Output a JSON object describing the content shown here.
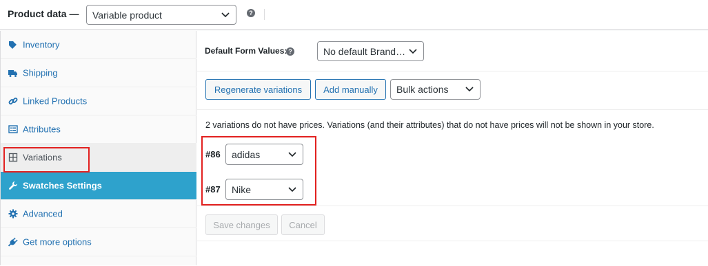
{
  "header": {
    "title": "Product data —",
    "product_type": "Variable product",
    "help_glyph": "?"
  },
  "sidebar": {
    "items": [
      {
        "label": "Inventory",
        "icon": "tag-icon"
      },
      {
        "label": "Shipping",
        "icon": "truck-icon"
      },
      {
        "label": "Linked Products",
        "icon": "link-icon"
      },
      {
        "label": "Attributes",
        "icon": "list-icon"
      },
      {
        "label": "Variations",
        "icon": "grid-icon",
        "state": "active"
      },
      {
        "label": "Swatches Settings",
        "icon": "wrench-icon",
        "state": "highlighted"
      },
      {
        "label": "Advanced",
        "icon": "gear-icon"
      },
      {
        "label": "Get more options",
        "icon": "plugin-icon"
      }
    ]
  },
  "panel": {
    "default_form_values_label": "Default Form Values:",
    "default_form_value": "No default Brand…",
    "buttons": {
      "regenerate": "Regenerate variations",
      "add_manually": "Add manually",
      "bulk_actions": "Bulk actions"
    },
    "notice": "2 variations do not have prices. Variations (and their attributes) that do not have prices will not be shown in your store.",
    "variations": [
      {
        "id": "#86",
        "value": "adidas"
      },
      {
        "id": "#87",
        "value": "Nike"
      }
    ],
    "save_changes": "Save changes",
    "cancel": "Cancel"
  },
  "colors": {
    "link_blue": "#2271b1",
    "highlight_tab": "#2ea2cc",
    "annotation_red": "#e2201f"
  }
}
